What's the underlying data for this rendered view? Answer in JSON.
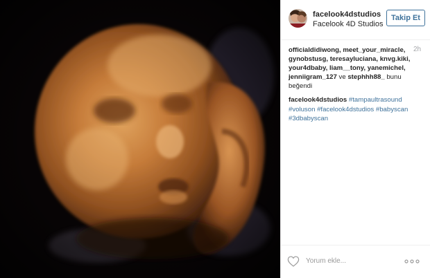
{
  "post": {
    "username": "facelook4dstudios",
    "location": "Facelook 4D Studios",
    "follow_label": "Takip Et",
    "timestamp": "2h",
    "likes": {
      "line1": "officialdidiwong, meet_your_miracle,",
      "line2": "gynobstusg, teresayluciana, knvg.kiki,",
      "line3": "your4dbaby, liam__tony, yanemichel,",
      "line4_user": "jenniigram_127",
      "line4_joiner": "ve",
      "line4_last": "stephhh88_",
      "line4_tail": "bunu",
      "line5": "beğendi"
    },
    "caption": {
      "username": "facelook4dstudios",
      "tags": [
        "#tampaultrasound",
        "#voluson",
        "#facelook4dstudios",
        "#babyscan",
        "#3dbabyscan"
      ]
    },
    "footer": {
      "comment_placeholder": "Yorum ekle...",
      "heart_icon": "heart-outline-icon",
      "more_icon": "more-options-icon"
    },
    "colors": {
      "link": "#3f729b",
      "text": "#262626",
      "muted": "#a5a7aa"
    }
  }
}
